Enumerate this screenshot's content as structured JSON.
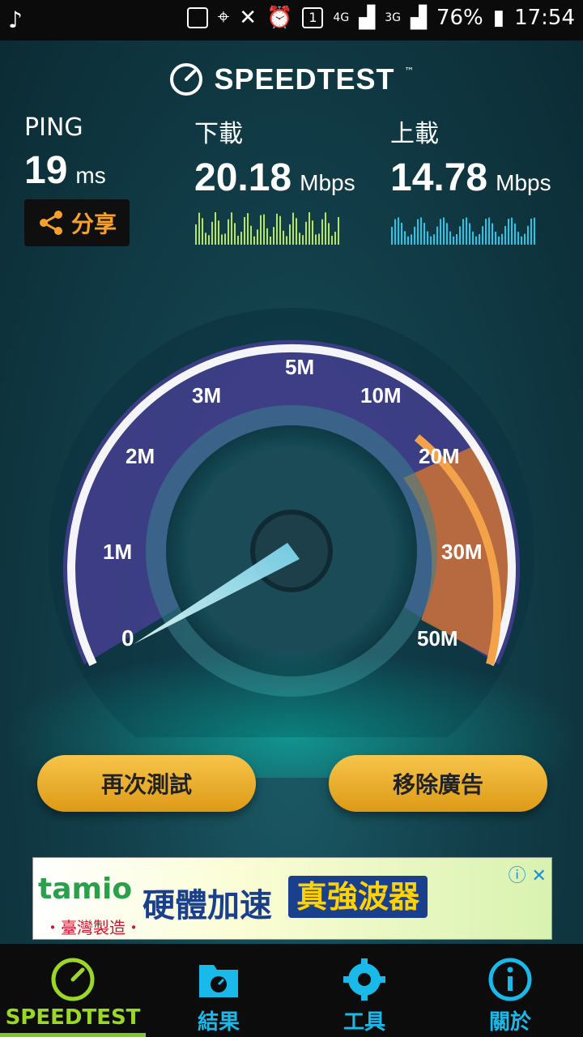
{
  "status_bar": {
    "battery": "76%",
    "time": "17:54",
    "network1": "4G",
    "network2": "3G",
    "sim": "1"
  },
  "header": {
    "title": "SPEEDTEST",
    "tm": "™"
  },
  "metrics": {
    "ping": {
      "label": "PING",
      "value": "19",
      "unit": "ms"
    },
    "download": {
      "label": "下載",
      "value": "20.18",
      "unit": "Mbps"
    },
    "upload": {
      "label": "上載",
      "value": "14.78",
      "unit": "Mbps"
    },
    "share_label": "分享"
  },
  "gauge": {
    "ticks": [
      "0",
      "1M",
      "2M",
      "3M",
      "5M",
      "10M",
      "20M",
      "30M",
      "50M"
    ],
    "colors": {
      "purple": "#7d53d6",
      "orange": "#f08a2c",
      "needle": "#bff5ff"
    }
  },
  "buttons": {
    "retest": "再次測試",
    "remove_ads": "移除廣告"
  },
  "ad": {
    "brand": "tamio",
    "made_in": "・臺灣製造・",
    "headline": "硬體加速",
    "highlight": "真強波器"
  },
  "nav": {
    "speedtest": "SPEEDTEST",
    "results": "結果",
    "tools": "工具",
    "about": "關於"
  }
}
